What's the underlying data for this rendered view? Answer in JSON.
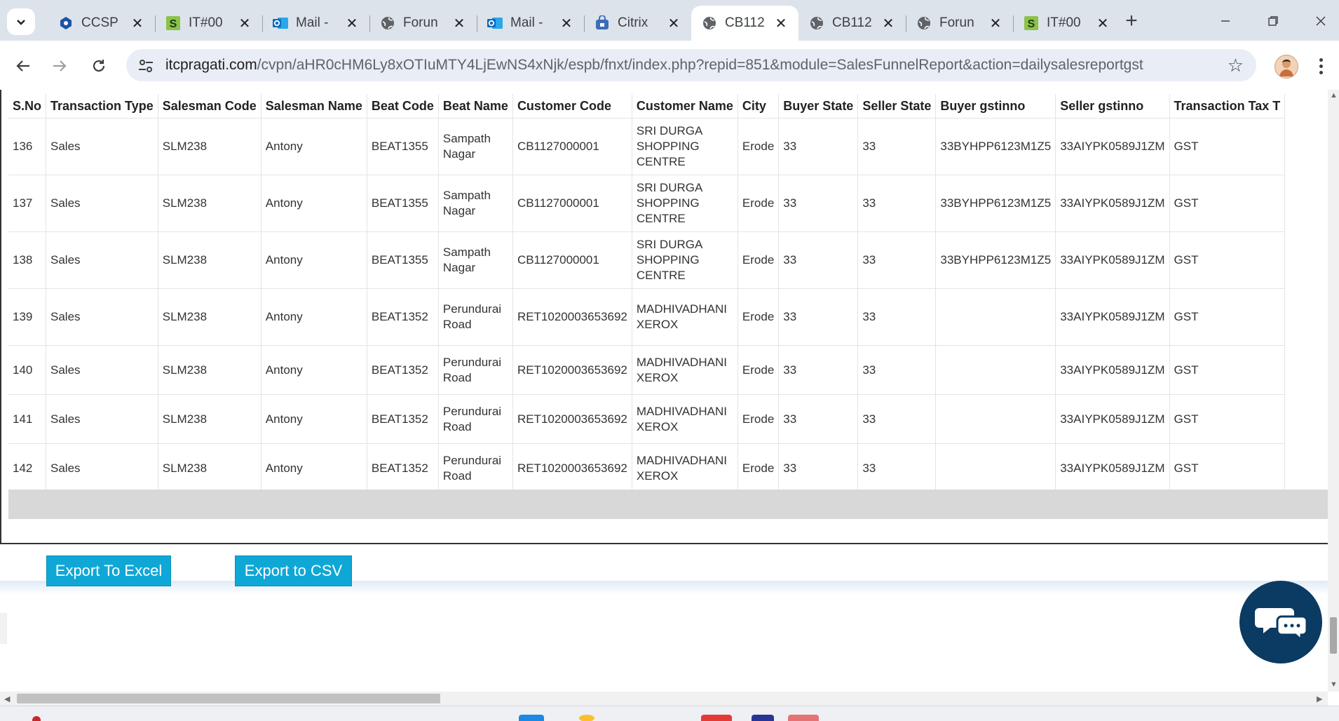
{
  "browser": {
    "tabs": [
      {
        "title": "CCSP",
        "icon": "ccsp-icon",
        "color": "#1a53a8"
      },
      {
        "title": "IT#00",
        "icon": "s-logo-icon",
        "color": "#8bc34a"
      },
      {
        "title": "Mail -",
        "icon": "outlook-icon",
        "color": "#0f6cbd"
      },
      {
        "title": "Forun",
        "icon": "globe-icon",
        "color": "#5f6368"
      },
      {
        "title": "Mail -",
        "icon": "outlook-icon",
        "color": "#0f6cbd"
      },
      {
        "title": "Citrix",
        "icon": "citrix-icon",
        "color": "#3b6db8"
      },
      {
        "title": "CB112",
        "icon": "globe-icon",
        "color": "#5f6368",
        "active": true
      },
      {
        "title": "CB112",
        "icon": "globe-icon",
        "color": "#5f6368"
      },
      {
        "title": "Forun",
        "icon": "globe-icon",
        "color": "#5f6368"
      },
      {
        "title": "IT#00",
        "icon": "s-logo-icon",
        "color": "#8bc34a"
      }
    ],
    "url_host": "itcpragati.com",
    "url_path": "/cvpn/aHR0cHM6Ly8xOTIuMTY4LjEwNS4xNjk/espb/fnxt/index.php?repid=851&module=SalesFunnelReport&action=dailysalesreportgst"
  },
  "report": {
    "columns": [
      "S.No",
      "Transaction Type",
      "Salesman Code",
      "Salesman Name",
      "Beat Code",
      "Beat Name",
      "Customer Code",
      "Customer Name",
      "City",
      "Buyer State",
      "Seller State",
      "Buyer gstinno",
      "Seller gstinno",
      "Transaction Tax T"
    ],
    "rows": [
      [
        "136",
        "Sales",
        "SLM238",
        "Antony",
        "BEAT1355",
        "Sampath Nagar",
        "CB1127000001",
        "SRI DURGA SHOPPING CENTRE",
        "Erode",
        "33",
        "33",
        "33BYHPP6123M1Z5",
        "33AIYPK0589J1ZM",
        "GST"
      ],
      [
        "137",
        "Sales",
        "SLM238",
        "Antony",
        "BEAT1355",
        "Sampath Nagar",
        "CB1127000001",
        "SRI DURGA SHOPPING CENTRE",
        "Erode",
        "33",
        "33",
        "33BYHPP6123M1Z5",
        "33AIYPK0589J1ZM",
        "GST"
      ],
      [
        "138",
        "Sales",
        "SLM238",
        "Antony",
        "BEAT1355",
        "Sampath Nagar",
        "CB1127000001",
        "SRI DURGA SHOPPING CENTRE",
        "Erode",
        "33",
        "33",
        "33BYHPP6123M1Z5",
        "33AIYPK0589J1ZM",
        "GST"
      ],
      [
        "139",
        "Sales",
        "SLM238",
        "Antony",
        "BEAT1352",
        "Perundurai Road",
        "RET1020003653692",
        "MADHIVADHANI XEROX",
        "Erode",
        "33",
        "33",
        "",
        "33AIYPK0589J1ZM",
        "GST"
      ],
      [
        "140",
        "Sales",
        "SLM238",
        "Antony",
        "BEAT1352",
        "Perundurai Road",
        "RET1020003653692",
        "MADHIVADHANI XEROX",
        "Erode",
        "33",
        "33",
        "",
        "33AIYPK0589J1ZM",
        "GST"
      ],
      [
        "141",
        "Sales",
        "SLM238",
        "Antony",
        "BEAT1352",
        "Perundurai Road",
        "RET1020003653692",
        "MADHIVADHANI XEROX",
        "Erode",
        "33",
        "33",
        "",
        "33AIYPK0589J1ZM",
        "GST"
      ],
      [
        "142",
        "Sales",
        "SLM238",
        "Antony",
        "BEAT1352",
        "Perundurai Road",
        "RET1020003653692",
        "MADHIVADHANI XEROX",
        "Erode",
        "33",
        "33",
        "",
        "33AIYPK0589J1ZM",
        "GST"
      ]
    ]
  },
  "actions": {
    "export_excel": "Export To Excel",
    "export_csv": "Export to CSV"
  },
  "colors": {
    "button": "#0fa7d6",
    "chat_bubble": "#0b3a62",
    "tabstrip": "#dde3ea"
  }
}
